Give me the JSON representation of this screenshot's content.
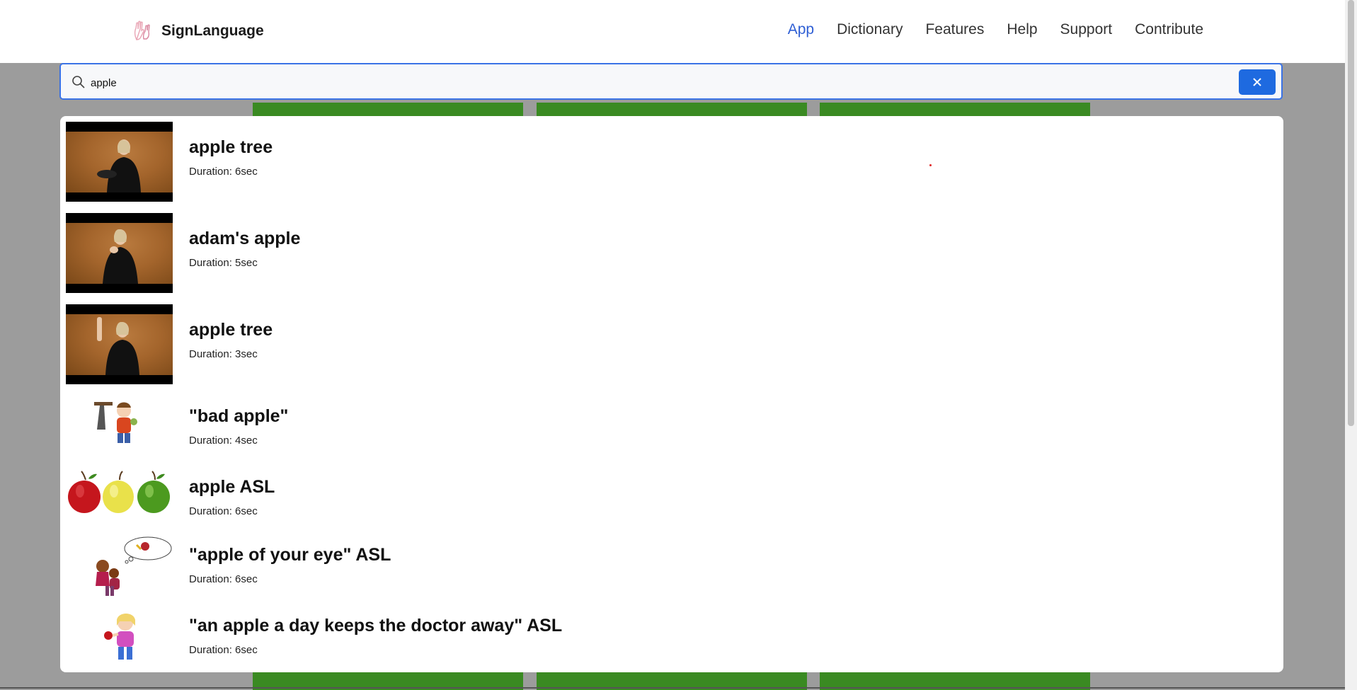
{
  "brand": {
    "name": "SignLanguage",
    "logo_icon": "hands-sign-icon"
  },
  "nav": {
    "items": [
      {
        "label": "App",
        "active": true
      },
      {
        "label": "Dictionary",
        "active": false
      },
      {
        "label": "Features",
        "active": false
      },
      {
        "label": "Help",
        "active": false
      },
      {
        "label": "Support",
        "active": false
      },
      {
        "label": "Contribute",
        "active": false
      }
    ]
  },
  "search": {
    "value": "apple",
    "icon": "search-icon",
    "clear_icon": "close-icon"
  },
  "results": [
    {
      "title": "apple tree",
      "duration": "Duration: 6sec",
      "thumb": "video"
    },
    {
      "title": "adam's apple",
      "duration": "Duration: 5sec",
      "thumb": "video"
    },
    {
      "title": "apple tree",
      "duration": "Duration: 3sec",
      "thumb": "video"
    },
    {
      "title": "\"bad apple\"",
      "duration": "Duration: 4sec",
      "thumb": "cartoon-bad-apple"
    },
    {
      "title": "apple ASL",
      "duration": "Duration: 6sec",
      "thumb": "three-apples"
    },
    {
      "title": "\"apple of your eye\" ASL",
      "duration": "Duration: 6sec",
      "thumb": "cartoon-apple-of-eye"
    },
    {
      "title": "\"an apple a day keeps the doctor away\" ASL",
      "duration": "Duration: 6sec",
      "thumb": "cartoon-apple-a-day"
    }
  ],
  "colors": {
    "accent": "#2f5fd4",
    "button": "#1e6ae0",
    "green_video": "#3a8a22"
  }
}
